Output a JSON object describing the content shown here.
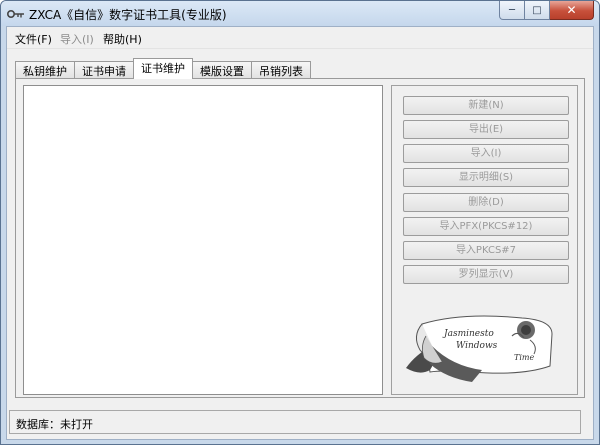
{
  "window": {
    "title": "ZXCA《自信》数字证书工具(专业版)",
    "icon": "key-icon",
    "controls": [
      "minimize",
      "maximize",
      "close"
    ]
  },
  "menu": [
    {
      "label": "文件(F)",
      "enabled": true
    },
    {
      "label": "导入(I)",
      "enabled": false
    },
    {
      "label": "帮助(H)",
      "enabled": true
    }
  ],
  "tabs": [
    {
      "label": "私钥维护",
      "active": false
    },
    {
      "label": "证书申请",
      "active": false
    },
    {
      "label": "证书维护",
      "active": true
    },
    {
      "label": "模版设置",
      "active": false
    },
    {
      "label": "吊销列表",
      "active": false
    }
  ],
  "buttons": [
    {
      "label": "新建(N)",
      "enabled": false
    },
    {
      "label": "导出(E)",
      "enabled": false
    },
    {
      "label": "导入(I)",
      "enabled": false
    },
    {
      "label": "显示明细(S)",
      "enabled": false
    },
    {
      "label": "删除(D)",
      "enabled": false
    },
    {
      "label": "导入PFX(PKCS#12)",
      "enabled": false
    },
    {
      "label": "导入PKCS#7",
      "enabled": false
    },
    {
      "label": "罗列显示(V)",
      "enabled": false
    }
  ],
  "logo": {
    "text_line1": "Jasminesto",
    "text_line2": "Windows",
    "text_line3": "Time"
  },
  "status": {
    "text": "数据库：未打开"
  },
  "colors": {
    "titlebar": "#c5d7ec",
    "close_button": "#c7503b",
    "disabled_text": "#9a9a9a"
  }
}
